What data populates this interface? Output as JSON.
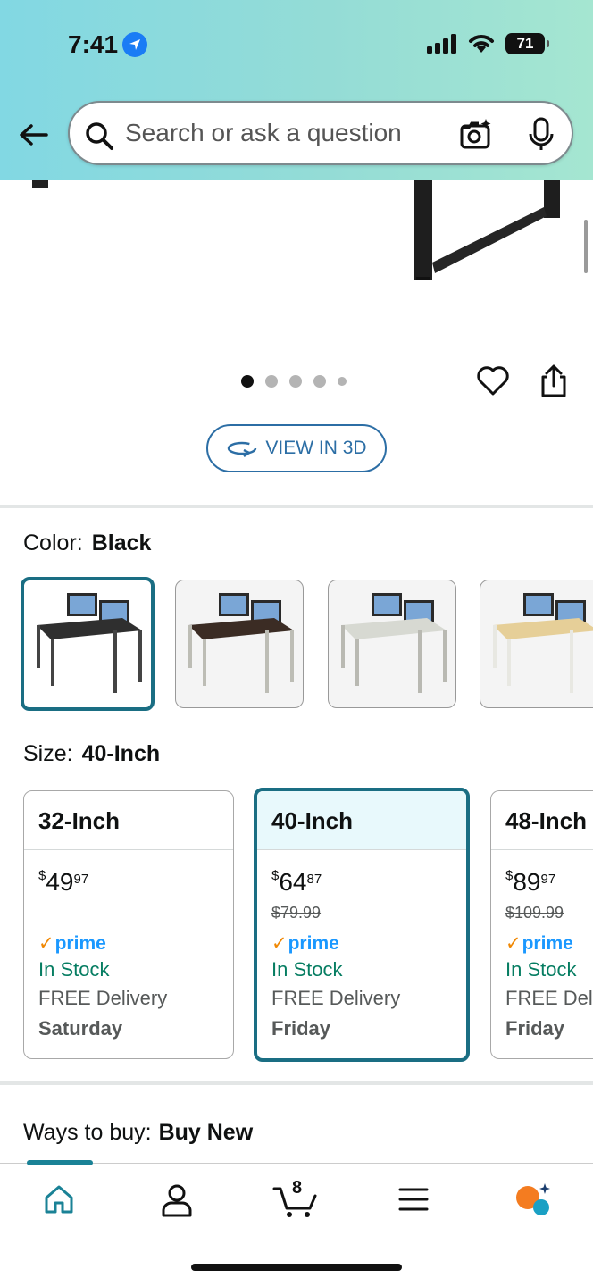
{
  "status_bar": {
    "time": "7:41",
    "battery": "71"
  },
  "search": {
    "placeholder": "Search or ask a question"
  },
  "gallery": {
    "view3d_label": "VIEW IN 3D"
  },
  "color": {
    "label": "Color:",
    "selected": "Black"
  },
  "size": {
    "label": "Size:",
    "selected": "40-Inch",
    "options": [
      {
        "name": "32-Inch",
        "currency": "$",
        "price_whole": "49",
        "price_fraction": "97",
        "list_price": "",
        "prime": "prime",
        "stock": "In Stock",
        "delivery": "FREE Delivery",
        "day": "Saturday"
      },
      {
        "name": "40-Inch",
        "currency": "$",
        "price_whole": "64",
        "price_fraction": "87",
        "list_price": "$79.99",
        "prime": "prime",
        "stock": "In Stock",
        "delivery": "FREE Delivery",
        "day": "Friday"
      },
      {
        "name": "48-Inch",
        "currency": "$",
        "price_whole": "89",
        "price_fraction": "97",
        "list_price": "$109.99",
        "prime": "prime",
        "stock": "In Stock",
        "delivery": "FREE Delivery",
        "day": "Friday"
      }
    ]
  },
  "ways_to_buy": {
    "label": "Ways to buy:",
    "value": "Buy New"
  },
  "bottom_nav": {
    "cart_count": "8"
  },
  "colors": {
    "accent": "#1a6e83",
    "prime_blue": "#1a98ff",
    "in_stock_green": "#067d62",
    "link_blue": "#2c6ea5"
  },
  "icons": [
    "back-arrow-icon",
    "search-icon",
    "camera-lens-icon",
    "microphone-icon",
    "location-arrow-icon",
    "heart-icon",
    "share-icon",
    "rotate-3d-icon",
    "home-icon",
    "account-icon",
    "cart-icon",
    "menu-icon",
    "rufus-icon"
  ]
}
